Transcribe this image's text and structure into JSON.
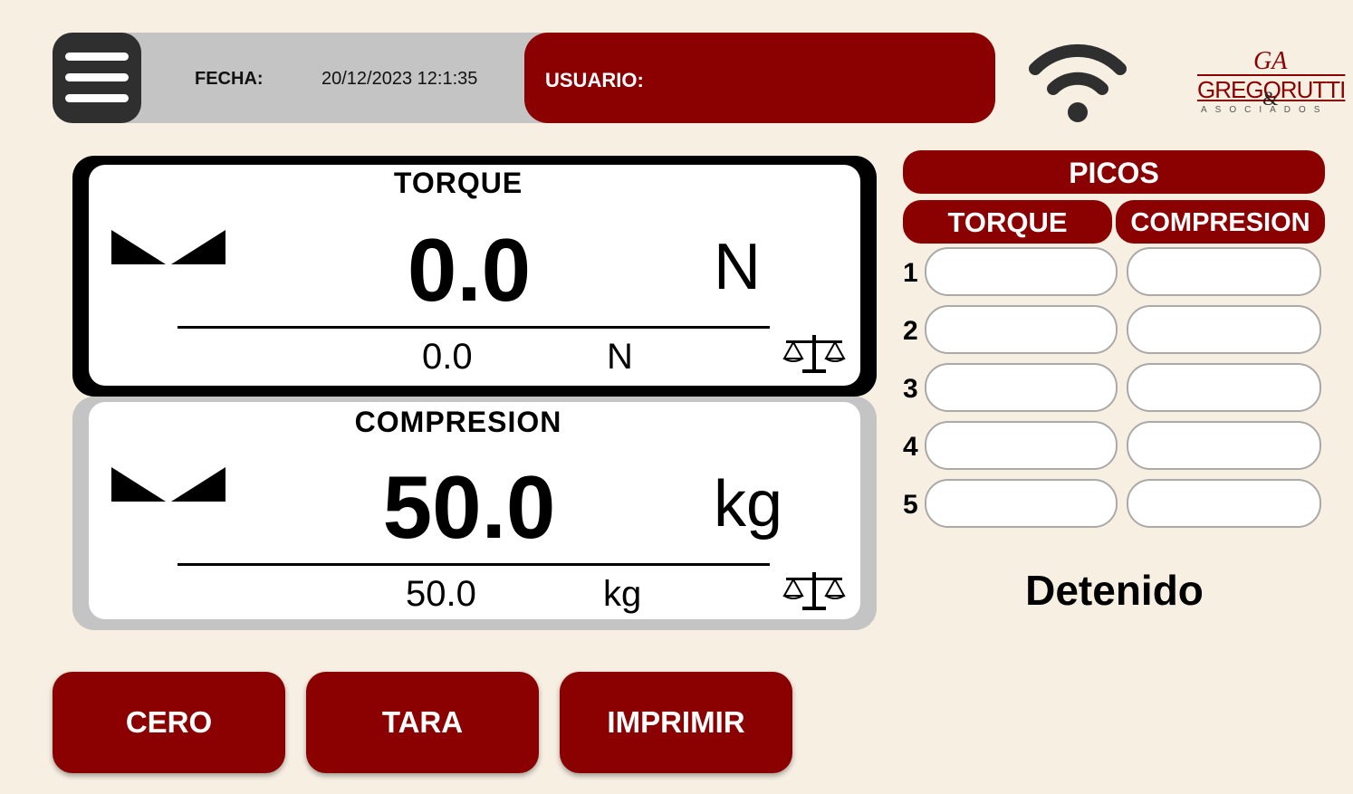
{
  "header": {
    "date_label": "FECHA:",
    "date_value": "20/12/2023 12:1:35",
    "user_label": "USUARIO:",
    "user_value": ""
  },
  "brand": {
    "logo_initials": "GA",
    "logo_name": "GREGORUTTI",
    "logo_amp": "&",
    "logo_sub": "ASOCIADOS"
  },
  "torque_panel": {
    "title": "TORQUE",
    "value": "0.0",
    "unit": "N",
    "sub_value": "0.0",
    "sub_unit": "N"
  },
  "compresion_panel": {
    "title": "COMPRESION",
    "value": "50.0",
    "unit": "kg",
    "sub_value": "50.0",
    "sub_unit": "kg"
  },
  "picos": {
    "title": "PICOS",
    "col_torque": "TORQUE",
    "col_compresion": "COMPRESION",
    "rows": [
      {
        "num": "1",
        "torque": "",
        "compresion": ""
      },
      {
        "num": "2",
        "torque": "",
        "compresion": ""
      },
      {
        "num": "3",
        "torque": "",
        "compresion": ""
      },
      {
        "num": "4",
        "torque": "",
        "compresion": ""
      },
      {
        "num": "5",
        "torque": "",
        "compresion": ""
      }
    ]
  },
  "status": "Detenido",
  "buttons": {
    "cero": "CERO",
    "tara": "TARA",
    "imprimir": "IMPRIMIR"
  },
  "colors": {
    "accent": "#8b0000",
    "background": "#f7efe2",
    "header_gray": "#c4c4c4"
  },
  "icons": [
    "menu-icon",
    "wifi-icon",
    "range-indicator-icon",
    "balance-scale-icon"
  ]
}
